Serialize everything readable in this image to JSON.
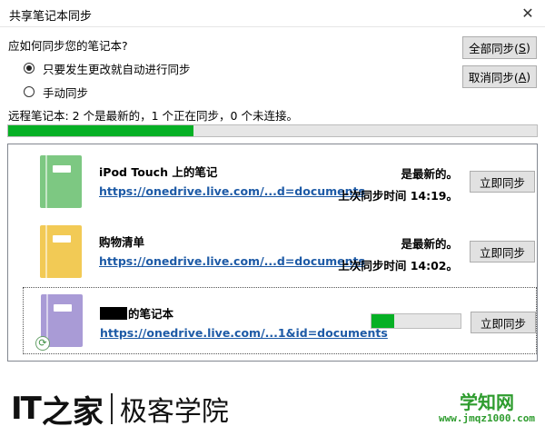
{
  "window": {
    "title": "共享笔记本同步",
    "close_glyph": "✕"
  },
  "question": "应如何同步您的笔记本?",
  "options": [
    {
      "label": "只要发生更改就自动进行同步",
      "checked": true
    },
    {
      "label": "手动同步",
      "checked": false
    }
  ],
  "buttons": {
    "sync_all": {
      "label": "全部同步(",
      "key": "S",
      "suffix": ")"
    },
    "cancel_sync": {
      "label": "取消同步(",
      "key": "A",
      "suffix": ")"
    }
  },
  "status_line": "远程笔记本: 2 个是最新的，1 个正在同步，0 个未连接。",
  "overall_progress": 0.35,
  "notebooks": [
    {
      "name": "iPod Touch 上的笔记",
      "url": "https://onedrive.live.com/...d=documents",
      "status": "是最新的。",
      "last_sync": "上次同步时间 14:19。",
      "button": "立即同步",
      "color": "#7dc882",
      "syncing": false
    },
    {
      "name": "购物清单",
      "url": "https://onedrive.live.com/...d=documents",
      "status": "是最新的。",
      "last_sync": "上次同步时间 14:02。",
      "button": "立即同步",
      "color": "#f2ca55",
      "syncing": false
    },
    {
      "name": "的笔记本",
      "url": "https://onedrive.live.com/...1&id=documents",
      "status": "",
      "last_sync": "",
      "button": "立即同步",
      "color": "#a99bd6",
      "syncing": true,
      "progress": 0.25,
      "sync_glyph": "⟳"
    }
  ],
  "watermark": {
    "left_logo": "IT",
    "left_glyph": "之家",
    "left_text": "极客学院",
    "right_big": "学知网",
    "right_small": "www.jmqz1000.com"
  }
}
